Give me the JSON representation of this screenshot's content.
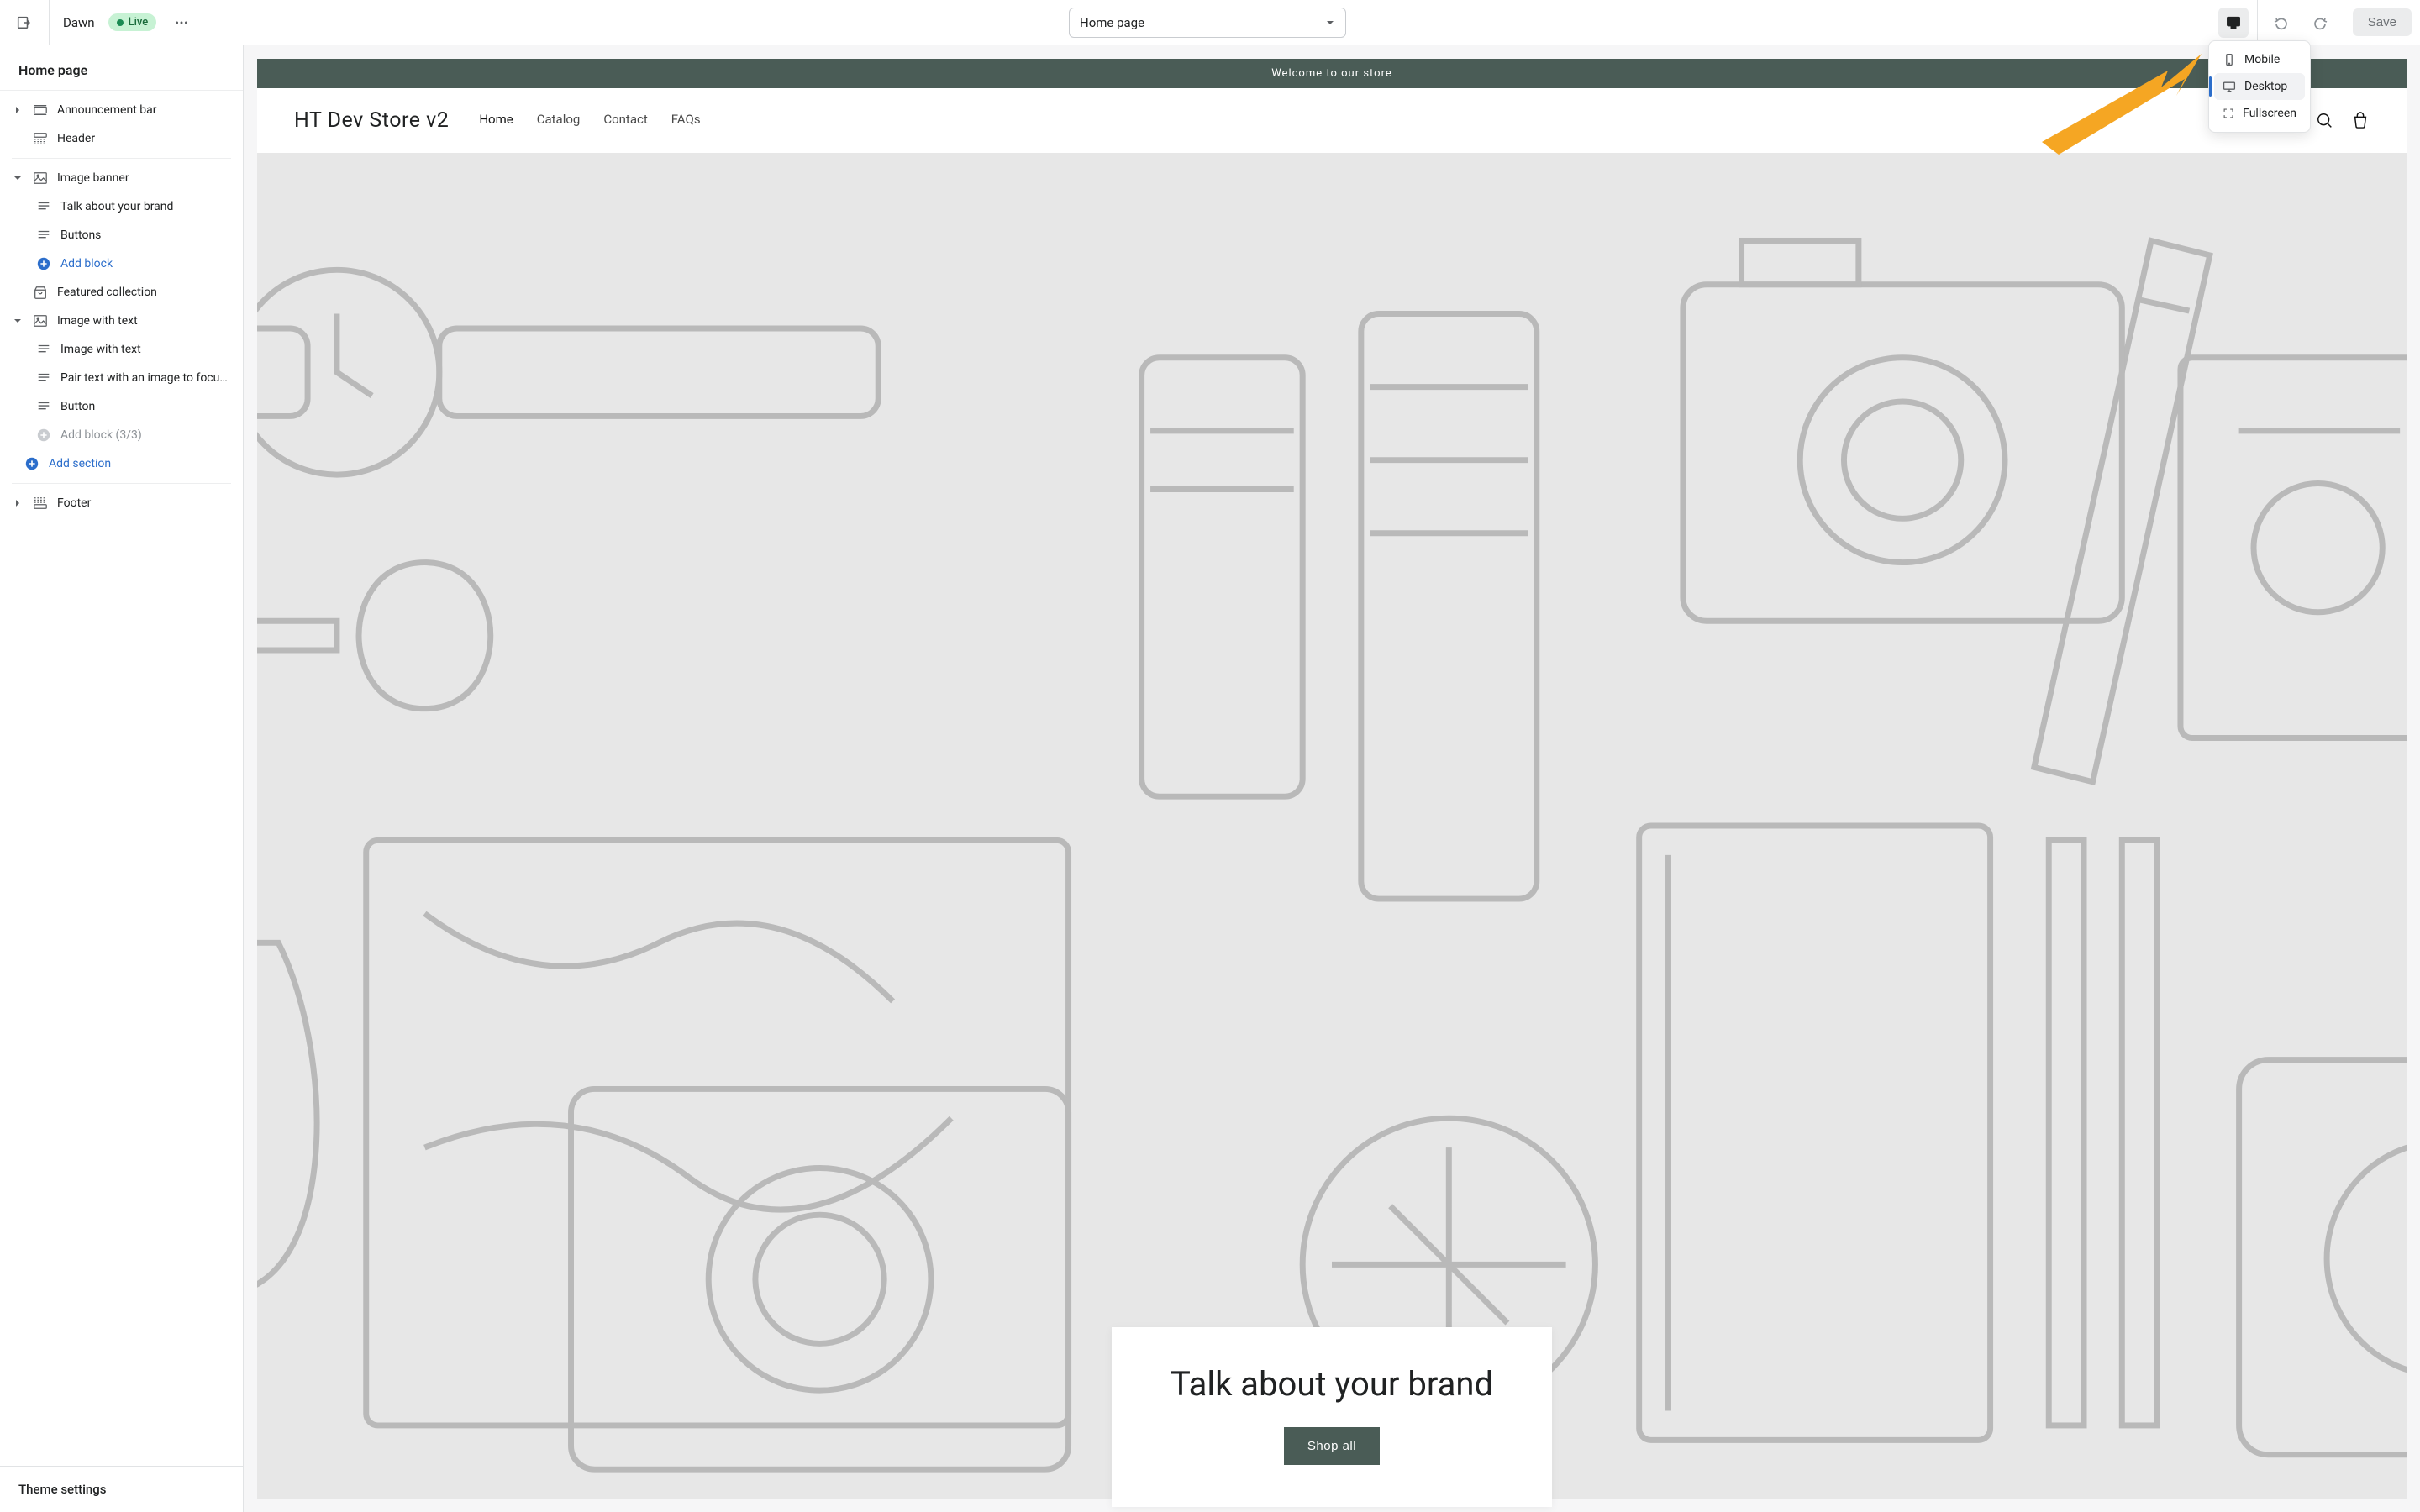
{
  "topbar": {
    "theme_name": "Dawn",
    "live_label": "Live",
    "page_select": "Home page",
    "save_label": "Save"
  },
  "viewport_menu": {
    "mobile": "Mobile",
    "desktop": "Desktop",
    "fullscreen": "Fullscreen"
  },
  "sidebar": {
    "title": "Home page",
    "sections": [
      {
        "label": "Announcement bar",
        "type": "section",
        "collapsible": true
      },
      {
        "label": "Header",
        "type": "section"
      },
      {
        "label": "Image banner",
        "type": "section-open",
        "collapsible": true,
        "children": [
          {
            "label": "Talk about your brand"
          },
          {
            "label": "Buttons"
          },
          {
            "label": "Add block",
            "add": true
          }
        ]
      },
      {
        "label": "Featured collection",
        "type": "section"
      },
      {
        "label": "Image with text",
        "type": "section-open",
        "collapsible": true,
        "children": [
          {
            "label": "Image with text"
          },
          {
            "label": "Pair text with an image to focu…"
          },
          {
            "label": "Button"
          },
          {
            "label": "Add block (3/3)",
            "add": true,
            "disabled": true
          }
        ]
      },
      {
        "label": "Add section",
        "add_section": true
      },
      {
        "label": "Footer",
        "type": "section",
        "collapsible": true,
        "separator_before": true
      }
    ],
    "footer": "Theme settings"
  },
  "preview": {
    "announcement": "Welcome to our store",
    "store_name": "HT Dev Store v2",
    "nav": [
      "Home",
      "Catalog",
      "Contact",
      "FAQs"
    ],
    "nav_active": 0,
    "hero_title": "Talk about your brand",
    "hero_button": "Shop all"
  }
}
